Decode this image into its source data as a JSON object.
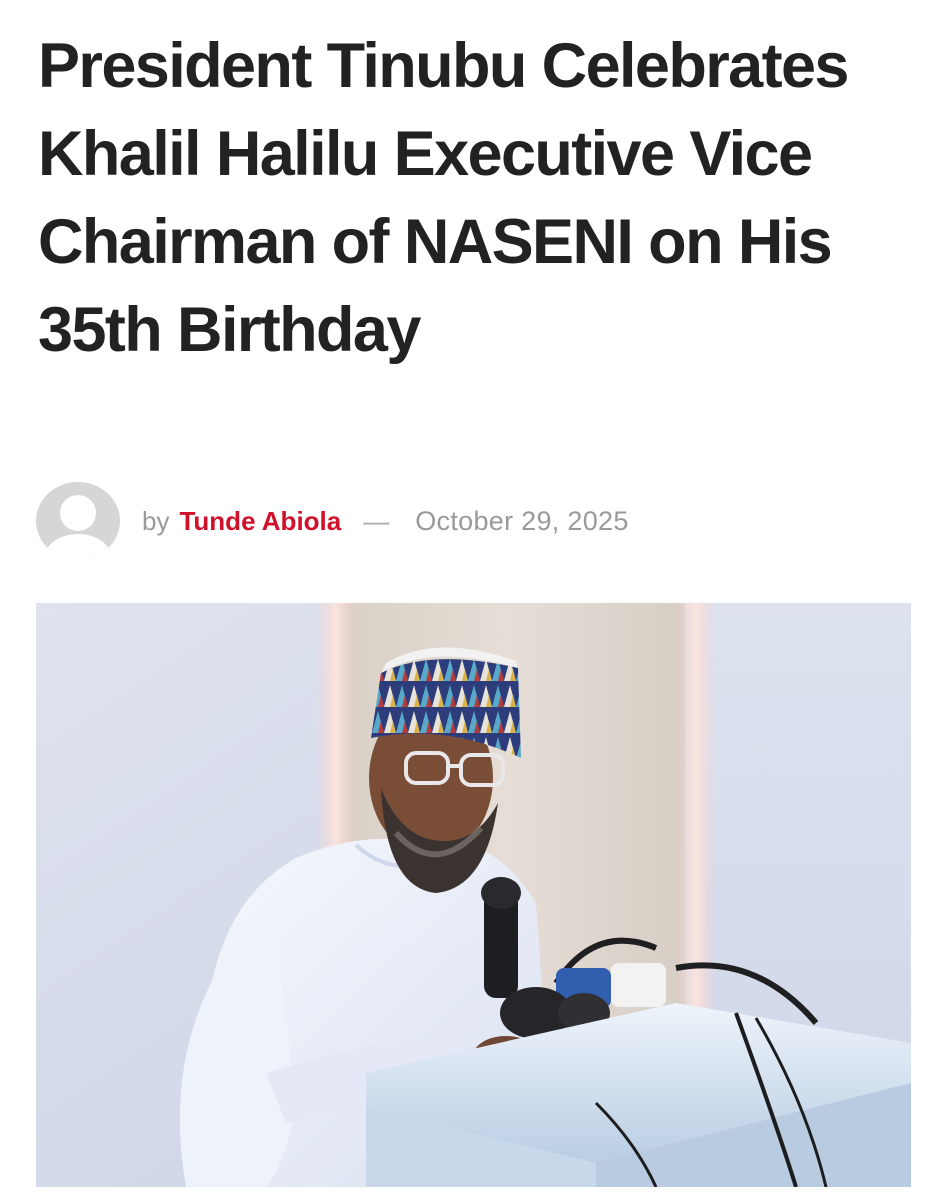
{
  "article": {
    "title": "President Tinubu Celebrates Khalil Halilu Executive Vice Chairman of NASENI on His 35th Birthday",
    "byline": {
      "prefix": "by",
      "author": "Tunde Abiola",
      "separator": "—",
      "date": "October 29, 2025"
    },
    "avatar_icon": "default-user-avatar-icon",
    "featured_image": {
      "subject": "man in white kaftan and patterned cap speaking at a podium with microphones"
    }
  },
  "colors": {
    "title": "#222222",
    "author": "#d0112b",
    "meta": "#9a9a9a",
    "background": "#ffffff"
  }
}
